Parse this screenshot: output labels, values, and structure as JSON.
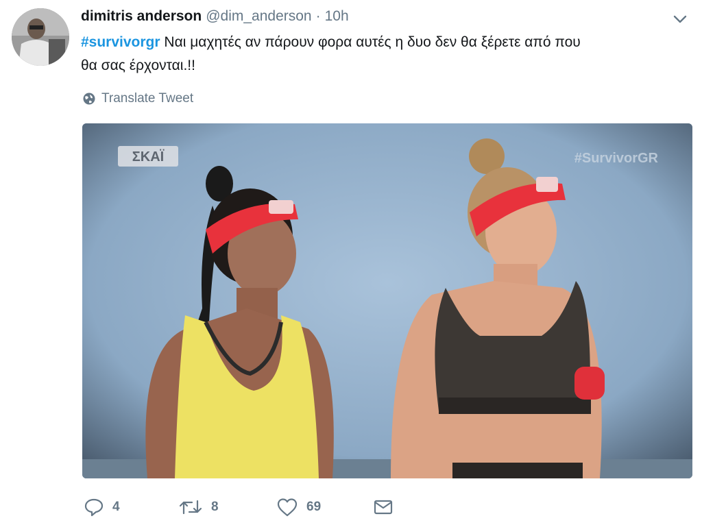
{
  "tweet": {
    "display_name": "dimitris anderson",
    "handle": "@dim_anderson",
    "separator": "·",
    "time": "10h",
    "hashtag": "#survivorgr",
    "text_line1": " Ναι μαχητές αν πάρουν φορα αυτές η δυο δεν θα ξέρετε από που",
    "text_line2": "θα σας έρχονται.!!",
    "translate_label": "Translate Tweet"
  },
  "media": {
    "channel_logo": "ΣΚΑΪ",
    "watermark": "#SurvivorGR"
  },
  "actions": {
    "reply_count": "4",
    "retweet_count": "8",
    "like_count": "69"
  },
  "icons": {
    "more": "chevron-down-icon",
    "translate": "globe-icon",
    "reply": "reply-icon",
    "retweet": "retweet-icon",
    "like": "heart-icon",
    "message": "envelope-icon"
  },
  "colors": {
    "link": "#1b95e0",
    "secondary_text": "#657786",
    "primary_text": "#14171a"
  }
}
